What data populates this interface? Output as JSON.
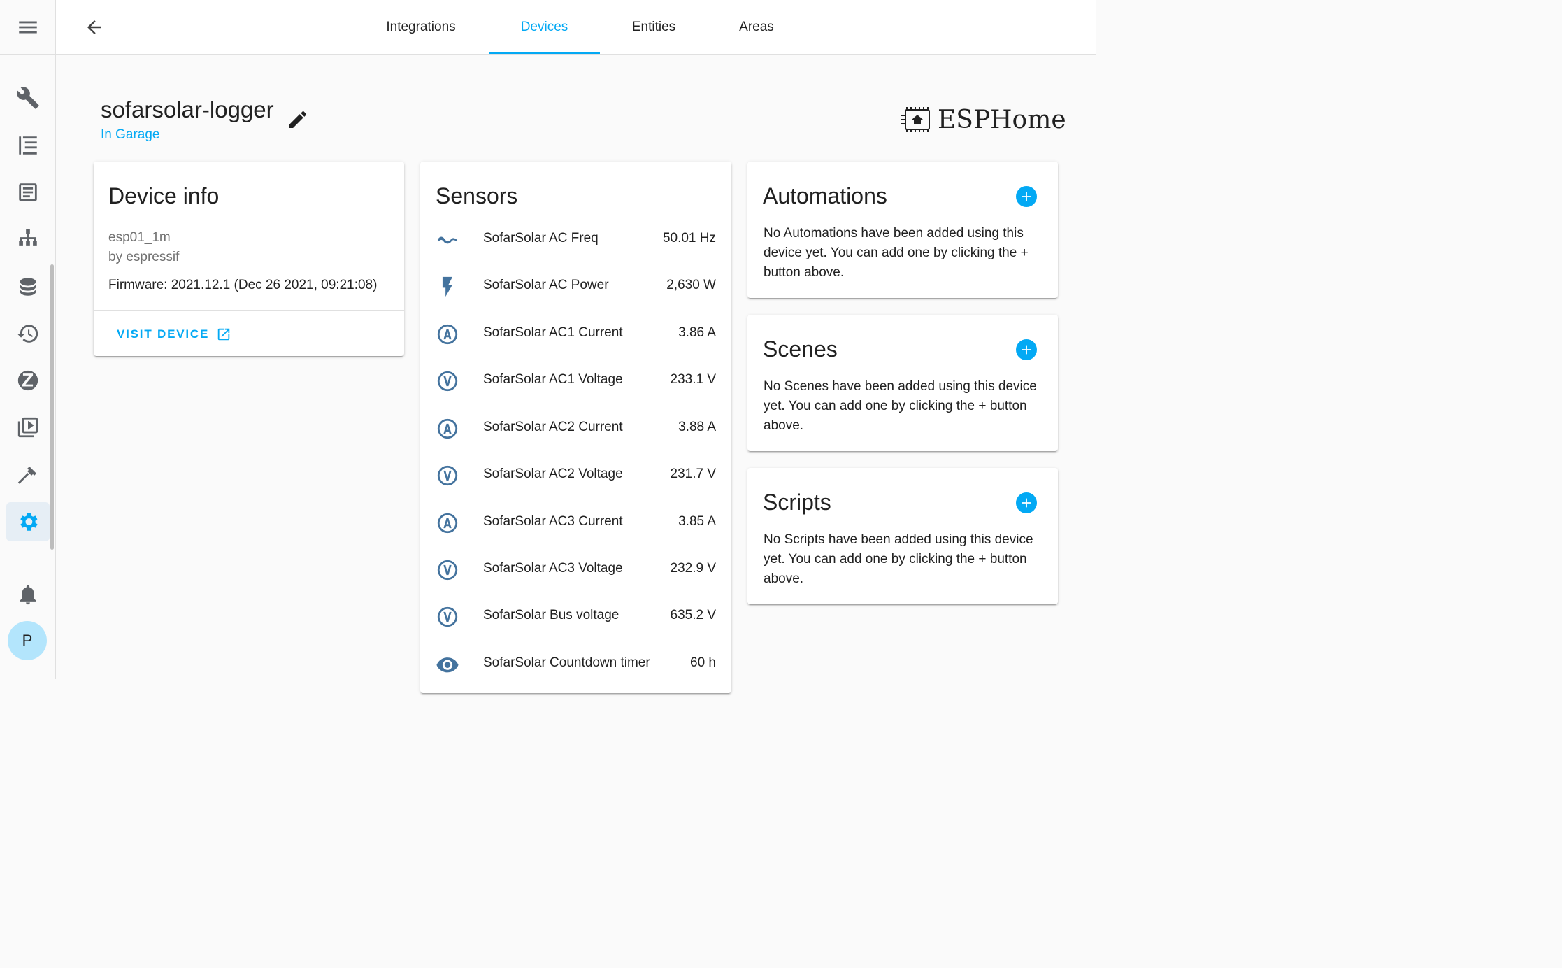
{
  "header": {
    "tabs": [
      {
        "label": "Integrations"
      },
      {
        "label": "Devices"
      },
      {
        "label": "Entities"
      },
      {
        "label": "Areas"
      }
    ],
    "active_tab": "Devices"
  },
  "sidebar": {
    "items": [
      "menu-icon",
      "developer-icon",
      "wrench-icon",
      "logbook-icon",
      "log-icon",
      "network-icon",
      "database-icon",
      "history-icon",
      "zigbee-icon",
      "media-icon",
      "hammer-icon",
      "settings-icon",
      "notifications-icon"
    ],
    "active": "settings-icon",
    "avatar_initial": "P"
  },
  "device": {
    "name": "sofarsolar-logger",
    "area": "In Garage",
    "brand": "ESPHome"
  },
  "device_info": {
    "title": "Device info",
    "model": "esp01_1m",
    "manufacturer": "by espressif",
    "firmware": "Firmware: 2021.12.1 (Dec 26 2021, 09:21:08)",
    "visit_label": "VISIT DEVICE"
  },
  "sensors": {
    "title": "Sensors",
    "rows": [
      {
        "icon": "sine-wave-icon",
        "name": "SofarSolar AC Freq",
        "value": "50.01 Hz"
      },
      {
        "icon": "flash-icon",
        "name": "SofarSolar AC Power",
        "value": "2,630 W"
      },
      {
        "icon": "current-icon",
        "name": "SofarSolar AC1 Current",
        "value": "3.86 A"
      },
      {
        "icon": "voltage-icon",
        "name": "SofarSolar AC1 Voltage",
        "value": "233.1 V"
      },
      {
        "icon": "current-icon",
        "name": "SofarSolar AC2 Current",
        "value": "3.88 A"
      },
      {
        "icon": "voltage-icon",
        "name": "SofarSolar AC2 Voltage",
        "value": "231.7 V"
      },
      {
        "icon": "current-icon",
        "name": "SofarSolar AC3 Current",
        "value": "3.85 A"
      },
      {
        "icon": "voltage-icon",
        "name": "SofarSolar AC3 Voltage",
        "value": "232.9 V"
      },
      {
        "icon": "voltage-icon",
        "name": "SofarSolar Bus voltage",
        "value": "635.2 V"
      },
      {
        "icon": "eye-icon",
        "name": "SofarSolar Countdown timer",
        "value": "60 h"
      }
    ]
  },
  "automations": {
    "title": "Automations",
    "text": "No Automations have been added using this device yet. You can add one by clicking the + button above."
  },
  "scenes": {
    "title": "Scenes",
    "text": "No Scenes have been added using this device yet. You can add one by clicking the + button above."
  },
  "scripts": {
    "title": "Scripts",
    "text": "No Scripts have been added using this device yet. You can add one by clicking the + button above."
  },
  "colors": {
    "accent": "#03a9f4",
    "sensor_icon": "#44739e",
    "background": "#fafafa"
  }
}
